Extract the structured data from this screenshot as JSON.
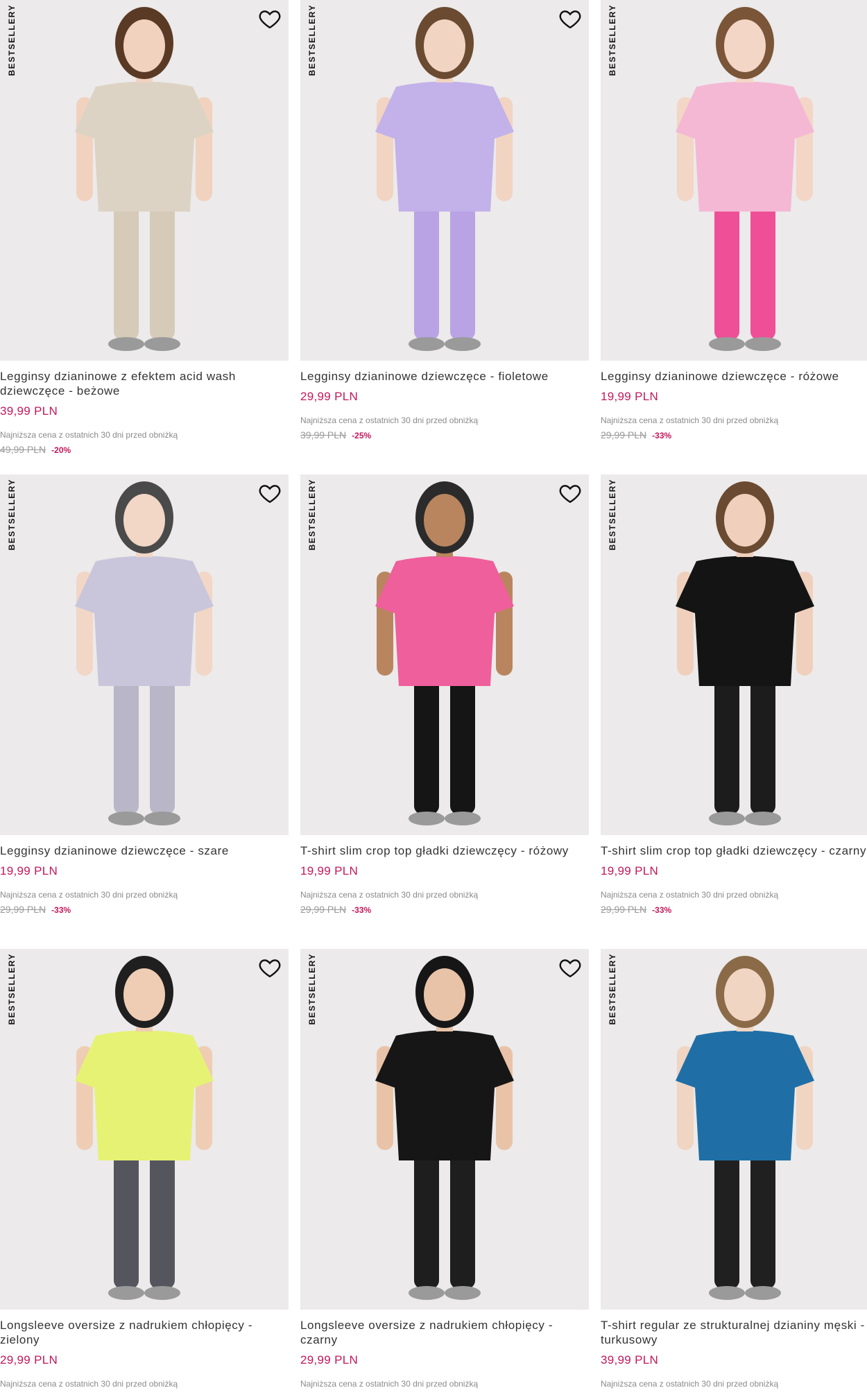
{
  "badge_text": "BESTSELLERY",
  "accent_price_color": "#c2185b",
  "products": [
    {
      "name": "Legginsy dzianinowe z efektem acid wash dziewczęce - beżowe",
      "price": "39,99 PLN",
      "lowest_label": "Najniższa cena z ostatnich 30 dni przed obniżką",
      "old_price": "49,99 PLN",
      "discount": "-20%",
      "top_color": "#ddd3c4",
      "bottom_color": "#d6cab8",
      "hair_color": "#5a3a25",
      "skin_color": "#f1d2bf"
    },
    {
      "name": "Legginsy dzianinowe dziewczęce - fioletowe",
      "price": "29,99 PLN",
      "lowest_label": "Najniższa cena z ostatnich 30 dni przed obniżką",
      "old_price": "39,99 PLN",
      "discount": "-25%",
      "top_color": "#c3b1ea",
      "bottom_color": "#b9a3e4",
      "hair_color": "#6a4a30",
      "skin_color": "#f2d4c2"
    },
    {
      "name": "Legginsy dzianinowe dziewczęce - różowe",
      "price": "19,99 PLN",
      "lowest_label": "Najniższa cena z ostatnich 30 dni przed obniżką",
      "old_price": "29,99 PLN",
      "discount": "-33%",
      "top_color": "#f4b8d4",
      "bottom_color": "#ee4f97",
      "hair_color": "#7a5538",
      "skin_color": "#f3d6c6"
    },
    {
      "name": "Legginsy dzianinowe dziewczęce - szare",
      "price": "19,99 PLN",
      "lowest_label": "Najniższa cena z ostatnich 30 dni przed obniżką",
      "old_price": "29,99 PLN",
      "discount": "-33%",
      "top_color": "#c9c6db",
      "bottom_color": "#b9b6c8",
      "hair_color": "#4a4a4a",
      "skin_color": "#f2d6c6"
    },
    {
      "name": "T-shirt slim crop top gładki dziewczęcy - różowy",
      "price": "19,99 PLN",
      "lowest_label": "Najniższa cena z ostatnich 30 dni przed obniżką",
      "old_price": "29,99 PLN",
      "discount": "-33%",
      "top_color": "#ef5f9c",
      "bottom_color": "#151515",
      "hair_color": "#2b2b2b",
      "skin_color": "#b9855f"
    },
    {
      "name": "T-shirt slim crop top gładki dziewczęcy - czarny",
      "price": "19,99 PLN",
      "lowest_label": "Najniższa cena z ostatnich 30 dni przed obniżką",
      "old_price": "29,99 PLN",
      "discount": "-33%",
      "top_color": "#141414",
      "bottom_color": "#1c1c1c",
      "hair_color": "#6b4a32",
      "skin_color": "#f0d0bd"
    },
    {
      "name": "Longsleeve oversize z nadrukiem chłopięcy - zielony",
      "price": "29,99 PLN",
      "lowest_label": "Najniższa cena z ostatnich 30 dni przed obniżką",
      "top_color": "#e6f274",
      "bottom_color": "#55555e",
      "hair_color": "#1f1f1f",
      "skin_color": "#efcdb4"
    },
    {
      "name": "Longsleeve oversize z nadrukiem chłopięcy - czarny",
      "price": "29,99 PLN",
      "lowest_label": "Najniższa cena z ostatnich 30 dni przed obniżką",
      "top_color": "#161616",
      "bottom_color": "#1e1e1e",
      "hair_color": "#161616",
      "skin_color": "#e9c3a8"
    },
    {
      "name": "T-shirt regular ze strukturalnej dzianiny męski - turkusowy",
      "price": "39,99 PLN",
      "lowest_label": "Najniższa cena z ostatnich 30 dni przed obniżką",
      "top_color": "#1f6fa6",
      "bottom_color": "#202020",
      "hair_color": "#8b6a48",
      "skin_color": "#f1d5c3"
    }
  ]
}
